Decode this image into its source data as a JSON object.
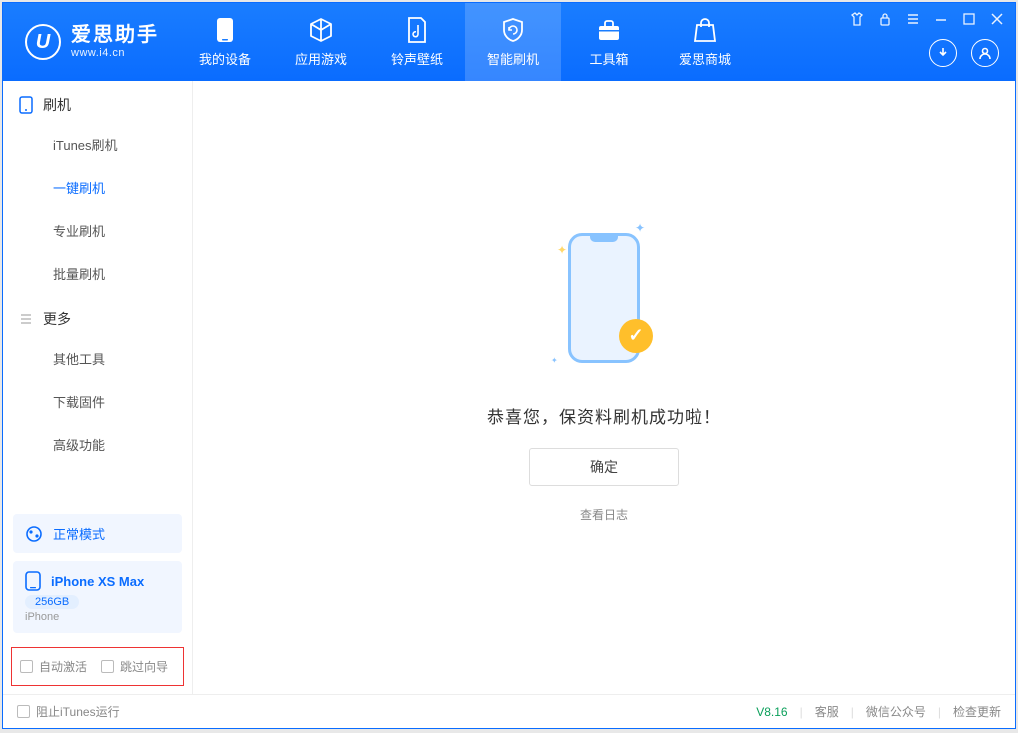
{
  "app": {
    "name": "爱思助手",
    "url": "www.i4.cn"
  },
  "tabs": [
    {
      "label": "我的设备"
    },
    {
      "label": "应用游戏"
    },
    {
      "label": "铃声壁纸"
    },
    {
      "label": "智能刷机"
    },
    {
      "label": "工具箱"
    },
    {
      "label": "爱思商城"
    }
  ],
  "sidebar": {
    "group1": "刷机",
    "items1": [
      "iTunes刷机",
      "一键刷机",
      "专业刷机",
      "批量刷机"
    ],
    "group2": "更多",
    "items2": [
      "其他工具",
      "下载固件",
      "高级功能"
    ]
  },
  "mode": {
    "label": "正常模式"
  },
  "device": {
    "name": "iPhone XS Max",
    "capacity": "256GB",
    "type": "iPhone"
  },
  "options": {
    "auto_activate": "自动激活",
    "skip_guide": "跳过向导"
  },
  "main": {
    "success": "恭喜您，保资料刷机成功啦！",
    "ok": "确定",
    "view_log": "查看日志"
  },
  "status": {
    "block_itunes": "阻止iTunes运行",
    "version": "V8.16",
    "support": "客服",
    "wechat": "微信公众号",
    "check_update": "检查更新"
  }
}
